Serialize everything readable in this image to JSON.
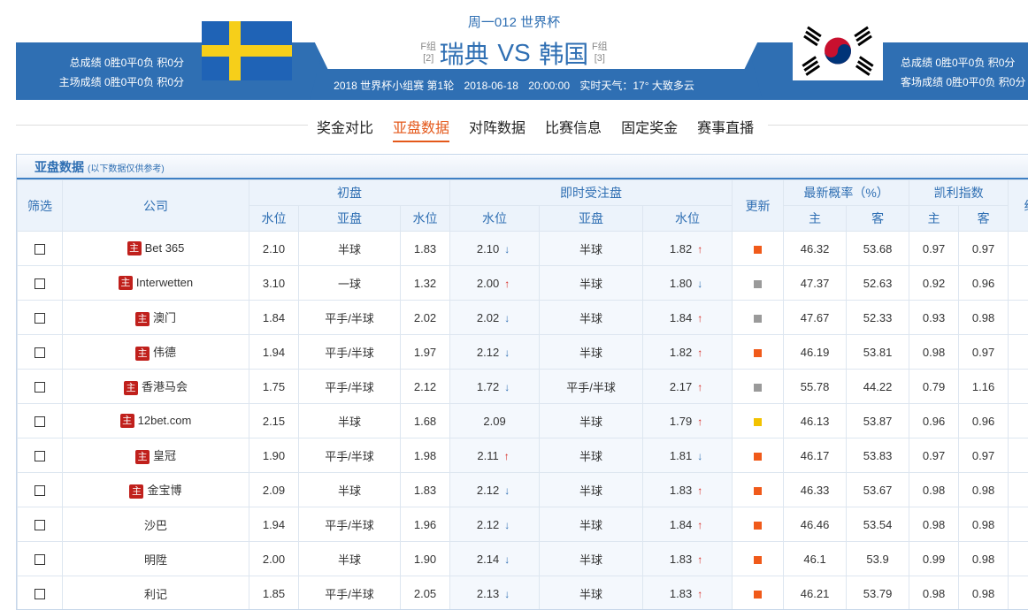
{
  "header": {
    "top_title": "周一012 世界杯",
    "home": {
      "name": "瑞典",
      "group": "F组",
      "rank": "[2]",
      "stats": [
        "总成绩 0胜0平0负 积0分",
        "主场成绩 0胜0平0负 积0分"
      ]
    },
    "away": {
      "name": "韩国",
      "group": "F组",
      "rank": "[3]",
      "stats": [
        "总成绩 0胜0平0负 积0分",
        "客场成绩 0胜0平0负 积0分"
      ]
    },
    "vs": "VS",
    "info": {
      "league": "2018 世界杯小组赛 第1轮",
      "date": "2018-06-18",
      "time": "20:00:00",
      "weather": "实时天气：17° 大致多云"
    }
  },
  "nav": {
    "items": [
      "奖金对比",
      "亚盘数据",
      "对阵数据",
      "比赛信息",
      "固定奖金",
      "赛事直播"
    ],
    "active": "亚盘数据"
  },
  "section": {
    "title": "亚盘数据",
    "note": "(以下数据仅供参考)"
  },
  "table": {
    "group_headers": {
      "filter": "筛选",
      "company": "公司",
      "initial": "初盘",
      "live": "即时受注盘",
      "update": "更新",
      "prob": "最新概率（%）",
      "kelly": "凯利指数",
      "extra": "统"
    },
    "sub_headers": {
      "water1": "水位",
      "handicap": "亚盘",
      "water2": "水位",
      "live_water1": "水位",
      "live_handicap": "亚盘",
      "live_water2": "水位",
      "prob_home": "主",
      "prob_away": "客",
      "kelly_home": "主",
      "kelly_away": "客"
    },
    "badge": "主",
    "rows": [
      {
        "company": "Bet 365",
        "main": true,
        "i_w1": "2.10",
        "i_hc": "半球",
        "i_w2": "1.83",
        "l_w1": "2.10",
        "l_w1_dir": "down",
        "l_hc": "半球",
        "l_w2": "1.82",
        "l_w2_dir": "up",
        "update": "orange",
        "p_home": "46.32",
        "p_away": "53.68",
        "k_home": "0.97",
        "k_away": "0.97"
      },
      {
        "company": "Interwetten",
        "main": true,
        "i_w1": "3.10",
        "i_hc": "一球",
        "i_w2": "1.32",
        "l_w1": "2.00",
        "l_w1_dir": "up",
        "l_hc": "半球",
        "l_w2": "1.80",
        "l_w2_dir": "down",
        "update": "gray",
        "p_home": "47.37",
        "p_away": "52.63",
        "k_home": "0.92",
        "k_away": "0.96"
      },
      {
        "company": "澳门",
        "main": true,
        "i_w1": "1.84",
        "i_hc": "平手/半球",
        "i_w2": "2.02",
        "l_w1": "2.02",
        "l_w1_dir": "down",
        "l_hc": "半球",
        "l_w2": "1.84",
        "l_w2_dir": "up",
        "update": "gray",
        "p_home": "47.67",
        "p_away": "52.33",
        "k_home": "0.93",
        "k_away": "0.98"
      },
      {
        "company": "伟德",
        "main": true,
        "i_w1": "1.94",
        "i_hc": "平手/半球",
        "i_w2": "1.97",
        "l_w1": "2.12",
        "l_w1_dir": "down",
        "l_hc": "半球",
        "l_w2": "1.82",
        "l_w2_dir": "up",
        "update": "orange",
        "p_home": "46.19",
        "p_away": "53.81",
        "k_home": "0.98",
        "k_away": "0.97"
      },
      {
        "company": "香港马会",
        "main": true,
        "i_w1": "1.75",
        "i_hc": "平手/半球",
        "i_w2": "2.12",
        "l_w1": "1.72",
        "l_w1_dir": "down",
        "l_hc": "平手/半球",
        "l_w2": "2.17",
        "l_w2_dir": "up",
        "update": "gray",
        "p_home": "55.78",
        "p_away": "44.22",
        "k_home": "0.79",
        "k_away": "1.16"
      },
      {
        "company": "12bet.com",
        "main": true,
        "i_w1": "2.15",
        "i_hc": "半球",
        "i_w2": "1.68",
        "l_w1": "2.09",
        "l_w1_dir": "",
        "l_hc": "半球",
        "l_w2": "1.79",
        "l_w2_dir": "up",
        "update": "yellow",
        "p_home": "46.13",
        "p_away": "53.87",
        "k_home": "0.96",
        "k_away": "0.96"
      },
      {
        "company": "皇冠",
        "main": true,
        "i_w1": "1.90",
        "i_hc": "平手/半球",
        "i_w2": "1.98",
        "l_w1": "2.11",
        "l_w1_dir": "up",
        "l_hc": "半球",
        "l_w2": "1.81",
        "l_w2_dir": "down",
        "update": "orange",
        "p_home": "46.17",
        "p_away": "53.83",
        "k_home": "0.97",
        "k_away": "0.97"
      },
      {
        "company": "金宝博",
        "main": true,
        "i_w1": "2.09",
        "i_hc": "半球",
        "i_w2": "1.83",
        "l_w1": "2.12",
        "l_w1_dir": "down",
        "l_hc": "半球",
        "l_w2": "1.83",
        "l_w2_dir": "up",
        "update": "orange",
        "p_home": "46.33",
        "p_away": "53.67",
        "k_home": "0.98",
        "k_away": "0.98"
      },
      {
        "company": "沙巴",
        "main": false,
        "i_w1": "1.94",
        "i_hc": "平手/半球",
        "i_w2": "1.96",
        "l_w1": "2.12",
        "l_w1_dir": "down",
        "l_hc": "半球",
        "l_w2": "1.84",
        "l_w2_dir": "up",
        "update": "orange",
        "p_home": "46.46",
        "p_away": "53.54",
        "k_home": "0.98",
        "k_away": "0.98"
      },
      {
        "company": "明陞",
        "main": false,
        "i_w1": "2.00",
        "i_hc": "半球",
        "i_w2": "1.90",
        "l_w1": "2.14",
        "l_w1_dir": "down",
        "l_hc": "半球",
        "l_w2": "1.83",
        "l_w2_dir": "up",
        "update": "orange",
        "p_home": "46.1",
        "p_away": "53.9",
        "k_home": "0.99",
        "k_away": "0.98"
      },
      {
        "company": "利记",
        "main": false,
        "i_w1": "1.85",
        "i_hc": "平手/半球",
        "i_w2": "2.05",
        "l_w1": "2.13",
        "l_w1_dir": "down",
        "l_hc": "半球",
        "l_w2": "1.83",
        "l_w2_dir": "up",
        "update": "orange",
        "p_home": "46.21",
        "p_away": "53.79",
        "k_home": "0.98",
        "k_away": "0.98"
      }
    ]
  },
  "colors": {
    "brand_blue": "#2f6fb3",
    "update_orange": "#f05a1a",
    "update_gray": "#9a9a9a",
    "update_yellow": "#f2c200",
    "arrow_up": "#d6241d",
    "arrow_down": "#2f6fb3"
  },
  "icons": {
    "arrow_up": "↑",
    "arrow_down": "↓"
  }
}
